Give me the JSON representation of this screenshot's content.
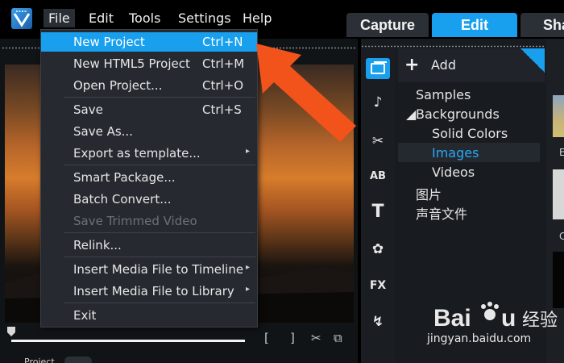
{
  "menubar": {
    "logo_icon": "app-logo-icon",
    "items": [
      {
        "label": "File"
      },
      {
        "label": "Edit"
      },
      {
        "label": "Tools"
      },
      {
        "label": "Settings"
      },
      {
        "label": "Help"
      }
    ]
  },
  "workspace_tabs": [
    {
      "label": "Capture"
    },
    {
      "label": "Edit"
    },
    {
      "label": "Sha"
    }
  ],
  "file_menu": {
    "items": [
      {
        "label": "New Project",
        "shortcut": "Ctrl+N"
      },
      {
        "label": "New HTML5 Project",
        "shortcut": "Ctrl+M"
      },
      {
        "label": "Open Project...",
        "shortcut": "Ctrl+O"
      },
      {
        "label": "Save",
        "shortcut": "Ctrl+S"
      },
      {
        "label": "Save As..."
      },
      {
        "label": "Export as template..."
      },
      {
        "label": "Smart Package..."
      },
      {
        "label": "Batch Convert..."
      },
      {
        "label": "Save Trimmed Video"
      },
      {
        "label": "Relink..."
      },
      {
        "label": "Insert Media File to Timeline"
      },
      {
        "label": "Insert Media File to Library"
      },
      {
        "label": "Exit"
      }
    ]
  },
  "library": {
    "add_label": "Add",
    "tree": [
      {
        "label": "Samples"
      },
      {
        "label": "Backgrounds"
      },
      {
        "label": "Solid Colors"
      },
      {
        "label": "Images"
      },
      {
        "label": "Videos"
      },
      {
        "label": "图片"
      },
      {
        "label": "声音文件"
      }
    ],
    "tools": [
      "media-icon",
      "audio-icon",
      "transition-icon",
      "title-icon",
      "text-icon",
      "graphics-icon",
      "fx-icon",
      "path-icon"
    ],
    "fx_label": "FX",
    "thumb_labels": [
      "E",
      "C"
    ]
  },
  "preview": {
    "project_label": "Project"
  },
  "watermark": {
    "text": "jingyan.baidu.com"
  },
  "colors": {
    "accent": "#18a0ee",
    "arrow": "#f2531b"
  }
}
